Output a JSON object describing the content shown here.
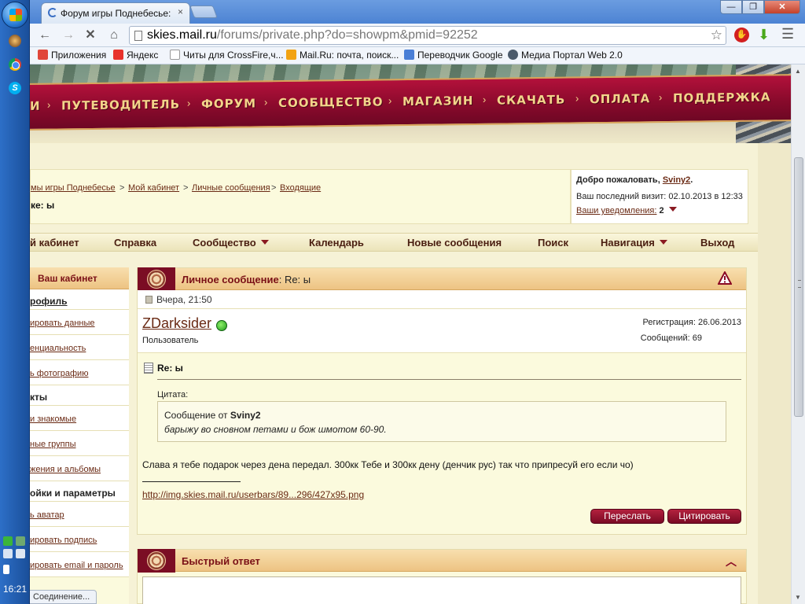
{
  "taskbar": {
    "clock": "16:21",
    "apps": [
      "game-icon",
      "chrome-icon",
      "skype-icon"
    ]
  },
  "browser": {
    "tab_title": "Форум игры Поднебесье: п",
    "tab_close": "×",
    "url_host": "skies.mail.ru",
    "url_path": "/forums/private.php?do=showpm&pmid=92252",
    "win_min": "—",
    "win_max": "❐",
    "win_close": "✕",
    "bookmarks": [
      {
        "label": "Приложения",
        "icon": "apps-icon",
        "color": "#e0463a"
      },
      {
        "label": "Яндекс",
        "icon": "yandex-icon",
        "color": "#e8332c"
      },
      {
        "label": "Читы для CrossFire,ч...",
        "icon": "page-icon",
        "color": "#ffffff"
      },
      {
        "label": "Mail.Ru: почта, поиск...",
        "icon": "mailru-icon",
        "color": "#f2a313"
      },
      {
        "label": "Переводчик Google",
        "icon": "translate-icon",
        "color": "#4a7fd6"
      },
      {
        "label": "Медиа Портал Web 2.0",
        "icon": "media-icon",
        "color": "#4b5a6b"
      }
    ],
    "status": "Соединение..."
  },
  "site_nav": [
    "И",
    "ПУТЕВОДИТЕЛЬ",
    "ФОРУМ",
    "СООБЩЕСТВО",
    "МАГАЗИН",
    "СКАЧАТЬ",
    "ОПЛАТА",
    "ПОДДЕРЖКА"
  ],
  "breadcrumb": {
    "items": [
      "мы игры Поднебесье",
      "Мой кабинет",
      "Личные сообщения",
      "Входящие"
    ],
    "separator": ">"
  },
  "page_heading": "ке: ы",
  "welcome": {
    "prefix": "Добро пожаловать, ",
    "user": "Sviny2",
    "suffix": ".",
    "last_visit": "Ваш последний визит: 02.10.2013 в 12:33",
    "notif_label": "Ваши уведомления:",
    "notif_count": "2"
  },
  "menu": [
    "й кабинет",
    "Справка",
    "Сообщество",
    "Календарь",
    "Новые сообщения",
    "Поиск",
    "Навигация",
    "Выход"
  ],
  "sidebar": {
    "title": "Ваш кабинет",
    "rows": [
      {
        "label": "рофиль",
        "type": "section-link"
      },
      {
        "label": "ировать данные",
        "type": "link"
      },
      {
        "label": "енциальность",
        "type": "link"
      },
      {
        "label": "ь фотографию",
        "type": "link"
      },
      {
        "label": "кты",
        "type": "section"
      },
      {
        "label": "и знакомые",
        "type": "link"
      },
      {
        "label": "ные группы",
        "type": "link"
      },
      {
        "label": "жения и альбомы",
        "type": "link"
      },
      {
        "label": "ойки и параметры",
        "type": "section"
      },
      {
        "label": "ь аватар",
        "type": "link"
      },
      {
        "label": "ировать подпись",
        "type": "link"
      },
      {
        "label": "ировать email и пароль",
        "type": "link"
      }
    ]
  },
  "pm": {
    "header_label": "Личное сообщение",
    "header_subject": ": Re: ы",
    "date": "Вчера, 21:50",
    "username": "ZDarksider",
    "user_title": "Пользователь",
    "registration": "Регистрация: 26.06.2013",
    "posts": "Сообщений: 69",
    "title": "Re: ы",
    "quote_label": "Цитата:",
    "quote_from_prefix": "Сообщение от ",
    "quote_author": "Sviny2",
    "quote_text": "барыжу во сновном петами и бож шмотом 60-90.",
    "message": "Слава я тебе подарок через дена передал. 300кк Тебе и 300кк дену (денчик рус) так что припресуй его если чо)",
    "signature_link": "http://img.skies.mail.ru/userbars/89...296/427x95.png",
    "forward_label": "Переслать",
    "quote_button_label": "Цитировать"
  },
  "quick_reply": {
    "title": "Быстрый ответ"
  }
}
